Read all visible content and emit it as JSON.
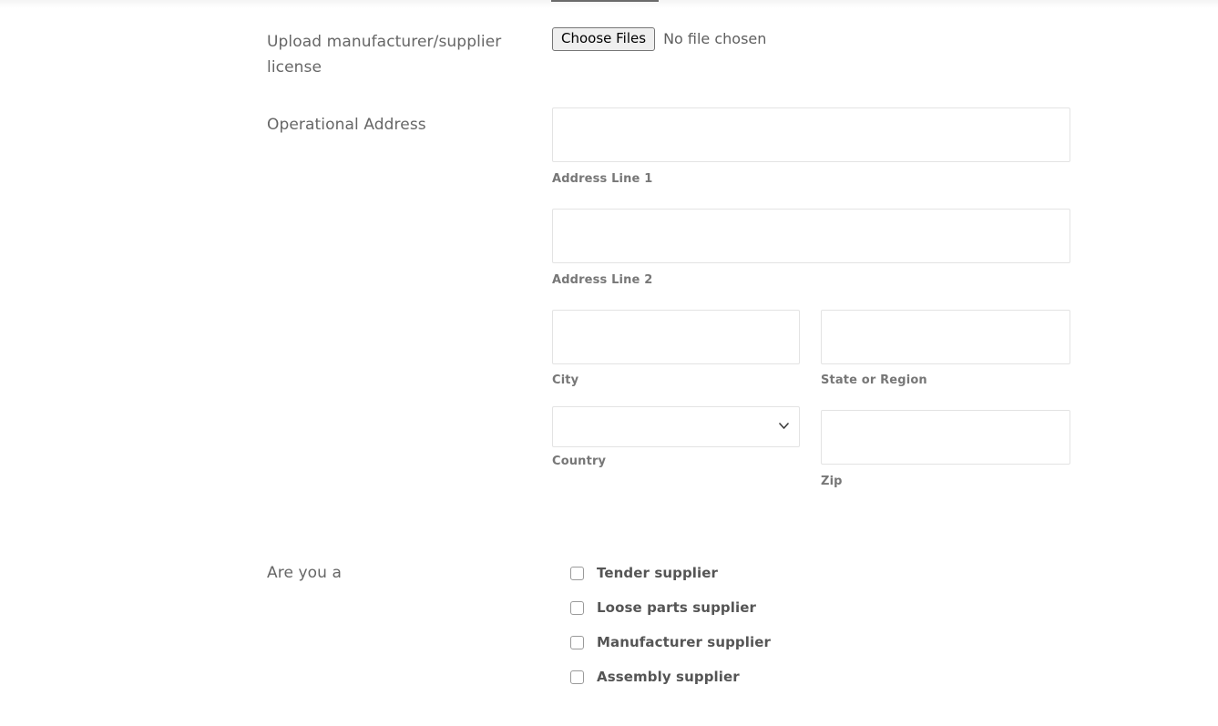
{
  "form": {
    "upload_section": {
      "label": "Upload manufacturer/supplier license",
      "choose_files_label": "Choose Files",
      "no_file_text": "No file chosen"
    },
    "address_section": {
      "label": "Operational Address",
      "fields": {
        "address_line_1": {
          "sub_label": "Address Line 1",
          "value": ""
        },
        "address_line_2": {
          "sub_label": "Address Line 2",
          "value": ""
        },
        "city": {
          "sub_label": "City",
          "value": ""
        },
        "state": {
          "sub_label": "State or Region",
          "value": ""
        },
        "country": {
          "sub_label": "Country",
          "selected": ""
        },
        "zip": {
          "sub_label": "Zip",
          "value": ""
        }
      }
    },
    "supplier_type_section": {
      "label": "Are you a",
      "options": [
        {
          "label": "Tender supplier",
          "checked": false
        },
        {
          "label": "Loose parts supplier",
          "checked": false
        },
        {
          "label": "Manufacturer supplier",
          "checked": false
        },
        {
          "label": "Assembly supplier",
          "checked": false
        }
      ]
    }
  },
  "icons": {
    "chevron_down": "chevron-down-icon"
  },
  "colors": {
    "main_label": "#666666",
    "sub_label": "#777777",
    "checkbox_label": "#555555",
    "input_border": "#e3e3e3",
    "button_border": "#767676",
    "button_bg": "#efefef"
  }
}
